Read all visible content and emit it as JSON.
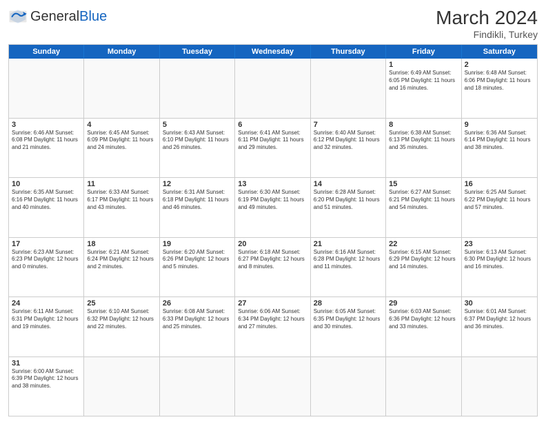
{
  "header": {
    "logo_general": "General",
    "logo_blue": "Blue",
    "month_year": "March 2024",
    "location": "Findikli, Turkey"
  },
  "day_headers": [
    "Sunday",
    "Monday",
    "Tuesday",
    "Wednesday",
    "Thursday",
    "Friday",
    "Saturday"
  ],
  "weeks": [
    [
      {
        "day": "",
        "empty": true,
        "info": ""
      },
      {
        "day": "",
        "empty": true,
        "info": ""
      },
      {
        "day": "",
        "empty": true,
        "info": ""
      },
      {
        "day": "",
        "empty": true,
        "info": ""
      },
      {
        "day": "",
        "empty": true,
        "info": ""
      },
      {
        "day": "1",
        "empty": false,
        "info": "Sunrise: 6:49 AM\nSunset: 6:05 PM\nDaylight: 11 hours and 16 minutes."
      },
      {
        "day": "2",
        "empty": false,
        "info": "Sunrise: 6:48 AM\nSunset: 6:06 PM\nDaylight: 11 hours and 18 minutes."
      }
    ],
    [
      {
        "day": "3",
        "empty": false,
        "info": "Sunrise: 6:46 AM\nSunset: 6:08 PM\nDaylight: 11 hours and 21 minutes."
      },
      {
        "day": "4",
        "empty": false,
        "info": "Sunrise: 6:45 AM\nSunset: 6:09 PM\nDaylight: 11 hours and 24 minutes."
      },
      {
        "day": "5",
        "empty": false,
        "info": "Sunrise: 6:43 AM\nSunset: 6:10 PM\nDaylight: 11 hours and 26 minutes."
      },
      {
        "day": "6",
        "empty": false,
        "info": "Sunrise: 6:41 AM\nSunset: 6:11 PM\nDaylight: 11 hours and 29 minutes."
      },
      {
        "day": "7",
        "empty": false,
        "info": "Sunrise: 6:40 AM\nSunset: 6:12 PM\nDaylight: 11 hours and 32 minutes."
      },
      {
        "day": "8",
        "empty": false,
        "info": "Sunrise: 6:38 AM\nSunset: 6:13 PM\nDaylight: 11 hours and 35 minutes."
      },
      {
        "day": "9",
        "empty": false,
        "info": "Sunrise: 6:36 AM\nSunset: 6:14 PM\nDaylight: 11 hours and 38 minutes."
      }
    ],
    [
      {
        "day": "10",
        "empty": false,
        "info": "Sunrise: 6:35 AM\nSunset: 6:16 PM\nDaylight: 11 hours and 40 minutes."
      },
      {
        "day": "11",
        "empty": false,
        "info": "Sunrise: 6:33 AM\nSunset: 6:17 PM\nDaylight: 11 hours and 43 minutes."
      },
      {
        "day": "12",
        "empty": false,
        "info": "Sunrise: 6:31 AM\nSunset: 6:18 PM\nDaylight: 11 hours and 46 minutes."
      },
      {
        "day": "13",
        "empty": false,
        "info": "Sunrise: 6:30 AM\nSunset: 6:19 PM\nDaylight: 11 hours and 49 minutes."
      },
      {
        "day": "14",
        "empty": false,
        "info": "Sunrise: 6:28 AM\nSunset: 6:20 PM\nDaylight: 11 hours and 51 minutes."
      },
      {
        "day": "15",
        "empty": false,
        "info": "Sunrise: 6:27 AM\nSunset: 6:21 PM\nDaylight: 11 hours and 54 minutes."
      },
      {
        "day": "16",
        "empty": false,
        "info": "Sunrise: 6:25 AM\nSunset: 6:22 PM\nDaylight: 11 hours and 57 minutes."
      }
    ],
    [
      {
        "day": "17",
        "empty": false,
        "info": "Sunrise: 6:23 AM\nSunset: 6:23 PM\nDaylight: 12 hours and 0 minutes."
      },
      {
        "day": "18",
        "empty": false,
        "info": "Sunrise: 6:21 AM\nSunset: 6:24 PM\nDaylight: 12 hours and 2 minutes."
      },
      {
        "day": "19",
        "empty": false,
        "info": "Sunrise: 6:20 AM\nSunset: 6:26 PM\nDaylight: 12 hours and 5 minutes."
      },
      {
        "day": "20",
        "empty": false,
        "info": "Sunrise: 6:18 AM\nSunset: 6:27 PM\nDaylight: 12 hours and 8 minutes."
      },
      {
        "day": "21",
        "empty": false,
        "info": "Sunrise: 6:16 AM\nSunset: 6:28 PM\nDaylight: 12 hours and 11 minutes."
      },
      {
        "day": "22",
        "empty": false,
        "info": "Sunrise: 6:15 AM\nSunset: 6:29 PM\nDaylight: 12 hours and 14 minutes."
      },
      {
        "day": "23",
        "empty": false,
        "info": "Sunrise: 6:13 AM\nSunset: 6:30 PM\nDaylight: 12 hours and 16 minutes."
      }
    ],
    [
      {
        "day": "24",
        "empty": false,
        "info": "Sunrise: 6:11 AM\nSunset: 6:31 PM\nDaylight: 12 hours and 19 minutes."
      },
      {
        "day": "25",
        "empty": false,
        "info": "Sunrise: 6:10 AM\nSunset: 6:32 PM\nDaylight: 12 hours and 22 minutes."
      },
      {
        "day": "26",
        "empty": false,
        "info": "Sunrise: 6:08 AM\nSunset: 6:33 PM\nDaylight: 12 hours and 25 minutes."
      },
      {
        "day": "27",
        "empty": false,
        "info": "Sunrise: 6:06 AM\nSunset: 6:34 PM\nDaylight: 12 hours and 27 minutes."
      },
      {
        "day": "28",
        "empty": false,
        "info": "Sunrise: 6:05 AM\nSunset: 6:35 PM\nDaylight: 12 hours and 30 minutes."
      },
      {
        "day": "29",
        "empty": false,
        "info": "Sunrise: 6:03 AM\nSunset: 6:36 PM\nDaylight: 12 hours and 33 minutes."
      },
      {
        "day": "30",
        "empty": false,
        "info": "Sunrise: 6:01 AM\nSunset: 6:37 PM\nDaylight: 12 hours and 36 minutes."
      }
    ],
    [
      {
        "day": "31",
        "empty": false,
        "info": "Sunrise: 6:00 AM\nSunset: 6:39 PM\nDaylight: 12 hours and 38 minutes."
      },
      {
        "day": "",
        "empty": true,
        "info": ""
      },
      {
        "day": "",
        "empty": true,
        "info": ""
      },
      {
        "day": "",
        "empty": true,
        "info": ""
      },
      {
        "day": "",
        "empty": true,
        "info": ""
      },
      {
        "day": "",
        "empty": true,
        "info": ""
      },
      {
        "day": "",
        "empty": true,
        "info": ""
      }
    ]
  ]
}
